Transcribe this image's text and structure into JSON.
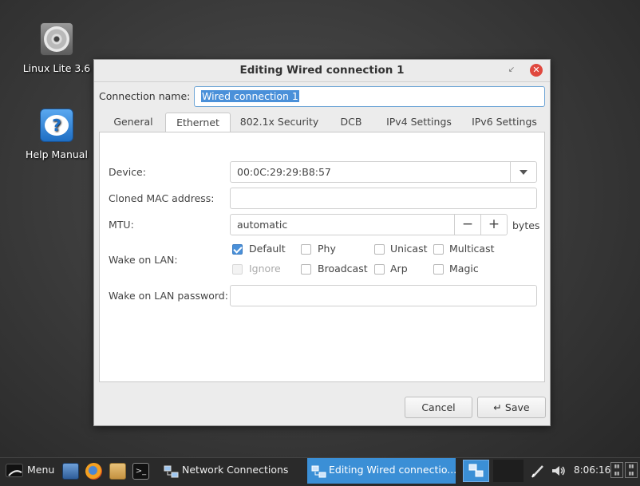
{
  "desktop": {
    "icons": [
      {
        "label": "Linux Lite 3.6",
        "icon": "dvd-icon"
      },
      {
        "label": "Help Manual",
        "icon": "help-icon"
      }
    ]
  },
  "window": {
    "title": "Editing Wired connection 1",
    "restore_glyph": "↙",
    "close_glyph": "✕",
    "connection_name_label": "Connection name:",
    "connection_name_value": "Wired connection 1",
    "tabs": [
      {
        "label": "General",
        "active": false
      },
      {
        "label": "Ethernet",
        "active": true
      },
      {
        "label": "802.1x Security",
        "active": false
      },
      {
        "label": "DCB",
        "active": false
      },
      {
        "label": "IPv4 Settings",
        "active": false
      },
      {
        "label": "IPv6 Settings",
        "active": false
      }
    ],
    "ethernet": {
      "device_label": "Device:",
      "device_value": "00:0C:29:29:B8:57",
      "cloned_mac_label": "Cloned MAC address:",
      "cloned_mac_value": "",
      "mtu_label": "MTU:",
      "mtu_value": "automatic",
      "mtu_minus": "−",
      "mtu_plus": "+",
      "mtu_unit": "bytes",
      "wol_label": "Wake on LAN:",
      "wol_options": [
        {
          "label": "Default",
          "checked": true,
          "disabled": false
        },
        {
          "label": "Phy",
          "checked": false,
          "disabled": false
        },
        {
          "label": "Unicast",
          "checked": false,
          "disabled": false
        },
        {
          "label": "Multicast",
          "checked": false,
          "disabled": false
        },
        {
          "label": "Ignore",
          "checked": false,
          "disabled": true
        },
        {
          "label": "Broadcast",
          "checked": false,
          "disabled": false
        },
        {
          "label": "Arp",
          "checked": false,
          "disabled": false
        },
        {
          "label": "Magic",
          "checked": false,
          "disabled": false
        }
      ],
      "wol_password_label": "Wake on LAN password:",
      "wol_password_value": ""
    },
    "buttons": {
      "cancel": "Cancel",
      "save": "Save",
      "save_glyph": "↵"
    }
  },
  "taskbar": {
    "menu_label": "Menu",
    "tasks": [
      {
        "label": "Network Connections",
        "active": false
      },
      {
        "label": "Editing Wired connectio...",
        "active": true
      }
    ],
    "clock": "8:06:16",
    "colors": {
      "active_task": "#3b8fd6",
      "taskbar_bg": "#2a2a2a"
    }
  }
}
